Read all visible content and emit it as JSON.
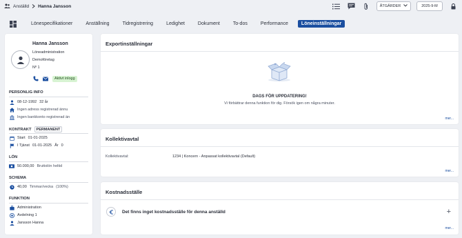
{
  "breadcrumb": {
    "parent": "Anställd",
    "current": "Hanna Jansson"
  },
  "topbar": {
    "actions_label": "ÅTGÄRDER",
    "period": "2025-9-M"
  },
  "tabs": [
    "Lönespecifikationer",
    "Anställning",
    "Tidregistrering",
    "Ledighet",
    "Dokument",
    "To-dos",
    "Performance",
    "Löneinställningar"
  ],
  "active_tab": 7,
  "profile": {
    "name": "Hanna Jansson",
    "role": "Löneadministration",
    "company": "Demoföretag",
    "number": "Nº 1",
    "status": "Aktivt inlogg"
  },
  "personal": {
    "title": "PERSONLIG INFO",
    "birth": "08-12-1992",
    "age": "32 år",
    "address": "Ingen adress registrerad ännu",
    "bank": "Ingen bankkonto registrerad än"
  },
  "contract": {
    "title": "KONTRAKT",
    "type": "PERMANENT",
    "start_label": "Start",
    "start": "01-01-2025",
    "service_label": "I Tjänst",
    "service_date": "01-01-2025",
    "years_label": "År",
    "years": "0"
  },
  "salary": {
    "title": "LÖN",
    "amount": "50.000,00",
    "type": "Bruttolön heltid"
  },
  "schedule": {
    "title": "SCHEMA",
    "hours": "40,00",
    "unit": "Timmar/vecka",
    "percent": "(100%)"
  },
  "function": {
    "title": "FUNKTION",
    "department": "Administration",
    "division": "Avdelning 1",
    "manager": "Jansson Hanna"
  },
  "export": {
    "title": "Exportinställningar",
    "heading": "DAGS FÖR UPPDATERING!",
    "message": "Vi förbättrar denna funktion för dig. Försök igen om några minuter.",
    "more": "mer..."
  },
  "collective": {
    "title": "Kollektivavtal",
    "label": "Kollektivavtal:",
    "value": "1234 | Koncern - Anpassat kollektivavtal (Default)",
    "more": "mer..."
  },
  "cost": {
    "title": "Kostnadsställe",
    "message": "Det finns inget kostnadsställe för denna anställd",
    "more": "mer..."
  },
  "colors": {
    "primary": "#1b4fa0",
    "badge_green": "#d7f3d2",
    "bg": "#eef0f4"
  }
}
